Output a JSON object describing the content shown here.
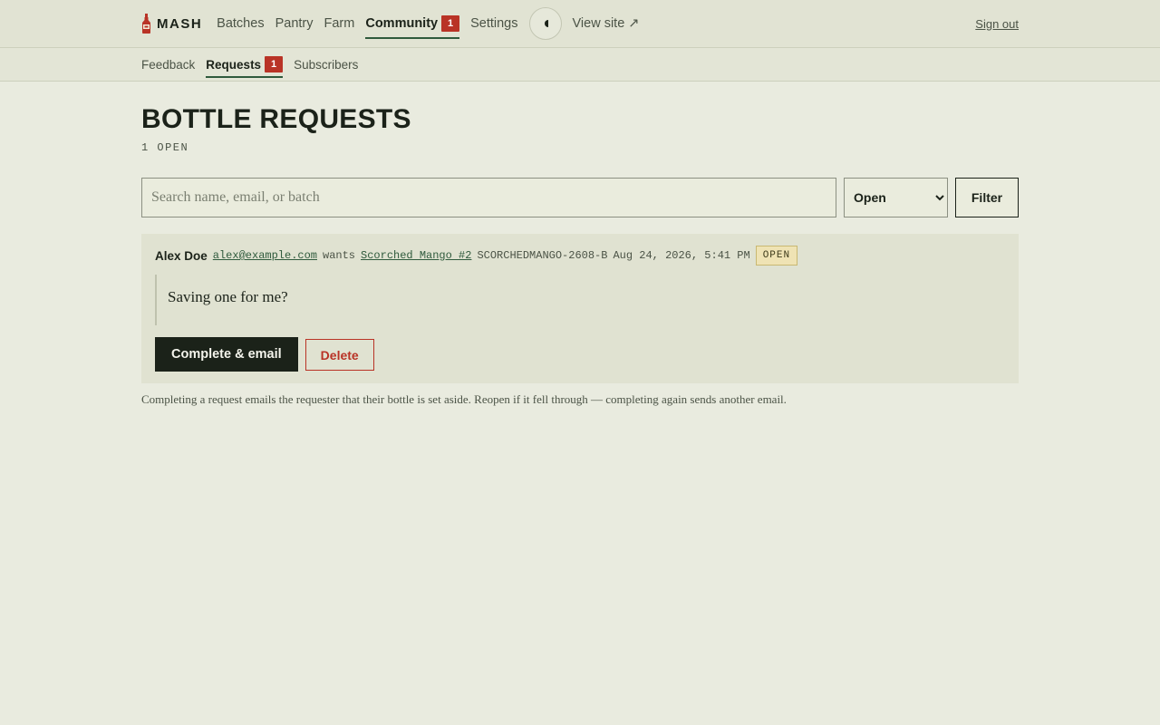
{
  "brand": {
    "name": "MASH",
    "icon": "hot-sauce-bottle-icon"
  },
  "nav": {
    "items": [
      {
        "label": "Batches"
      },
      {
        "label": "Pantry"
      },
      {
        "label": "Farm"
      },
      {
        "label": "Community",
        "badge": "1"
      },
      {
        "label": "Settings"
      }
    ],
    "theme_toggle_icon": "half-moon-icon",
    "view_site_label": "View site ↗",
    "sign_out_label": "Sign out"
  },
  "subnav": {
    "items": [
      {
        "label": "Feedback"
      },
      {
        "label": "Requests",
        "badge": "1"
      },
      {
        "label": "Subscribers"
      }
    ]
  },
  "page": {
    "title": "BOTTLE REQUESTS",
    "open_count": "1 OPEN"
  },
  "filters": {
    "search_placeholder": "Search name, email, or batch",
    "status_selected": "Open",
    "filter_label": "Filter"
  },
  "requests": [
    {
      "name": "Alex Doe",
      "email": "alex@example.com",
      "verb": "wants",
      "batch_name": "Scorched Mango #2",
      "batch_code": "SCORCHEDMANGO-2608-B",
      "date": "Aug 24, 2026, 5:41 PM",
      "status": "OPEN",
      "message": "Saving one for me?",
      "complete_label": "Complete & email",
      "delete_label": "Delete"
    }
  ],
  "help_text": "Completing a request emails the requester that their bottle is set aside. Reopen if it fell through — completing again sends another email.",
  "colors": {
    "background": "#e9ebdf",
    "accent": "#2f5a3c",
    "badge": "#b93326",
    "dark": "#1b2219"
  }
}
